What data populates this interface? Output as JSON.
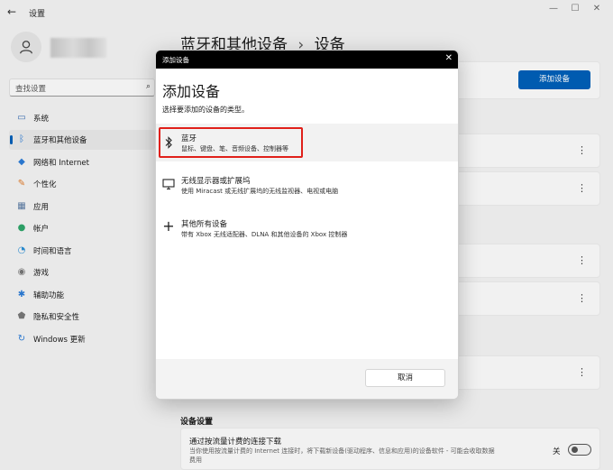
{
  "window": {
    "back_icon": "back-arrow-icon",
    "title": "设置",
    "controls": [
      "—",
      "☐",
      "✕"
    ]
  },
  "sidebar": {
    "search_placeholder": "查找设置",
    "items": [
      {
        "label": "系统",
        "icon": "monitor-icon",
        "color": "#3a6fb5"
      },
      {
        "label": "蓝牙和其他设备",
        "icon": "bluetooth-icon",
        "color": "#2b7bd6",
        "active": true
      },
      {
        "label": "网络和 Internet",
        "icon": "wifi-icon",
        "color": "#2b7bd6"
      },
      {
        "label": "个性化",
        "icon": "brush-icon",
        "color": "#e07b2a"
      },
      {
        "label": "应用",
        "icon": "apps-icon",
        "color": "#5a7aa3"
      },
      {
        "label": "帐户",
        "icon": "person-icon",
        "color": "#2ea56a"
      },
      {
        "label": "时间和语言",
        "icon": "clock-globe-icon",
        "color": "#2b8fd6"
      },
      {
        "label": "游戏",
        "icon": "gamepad-icon",
        "color": "#777777"
      },
      {
        "label": "辅助功能",
        "icon": "accessibility-icon",
        "color": "#2b7bd6"
      },
      {
        "label": "隐私和安全性",
        "icon": "shield-icon",
        "color": "#777777"
      },
      {
        "label": "Windows 更新",
        "icon": "update-icon",
        "color": "#2b7bd6"
      }
    ]
  },
  "main": {
    "breadcrumb_parent": "蓝牙和其他设备",
    "breadcrumb_sep": "›",
    "breadcrumb_current": "设备",
    "add_device_button": "添加设备",
    "section_label": "设备设置",
    "metered_title": "通过按流量计费的连接下载",
    "metered_desc": "当你使用按流量计费的 Internet 连接时，将下载新设备(驱动程序、信息和应用)的设备软件 - 可能会收取数据费用",
    "toggle_label": "关"
  },
  "dialog": {
    "titlebar": "添加设备",
    "close_icon": "close-icon",
    "heading": "添加设备",
    "subtitle": "选择要添加的设备的类型。",
    "options": [
      {
        "title": "蓝牙",
        "desc": "鼠标、键盘、笔、音频设备、控制器等",
        "icon": "bluetooth-icon"
      },
      {
        "title": "无线显示器或扩展坞",
        "desc": "使用 Miracast 或无线扩展坞的无线监视器、电视或电脑",
        "icon": "monitor-icon"
      },
      {
        "title": "其他所有设备",
        "desc": "带有 Xbox 无线适配器、DLNA 和其他设备的 Xbox 控制器",
        "icon": "plus-icon"
      }
    ],
    "cancel_button": "取消",
    "highlight_color": "#e0201a"
  }
}
